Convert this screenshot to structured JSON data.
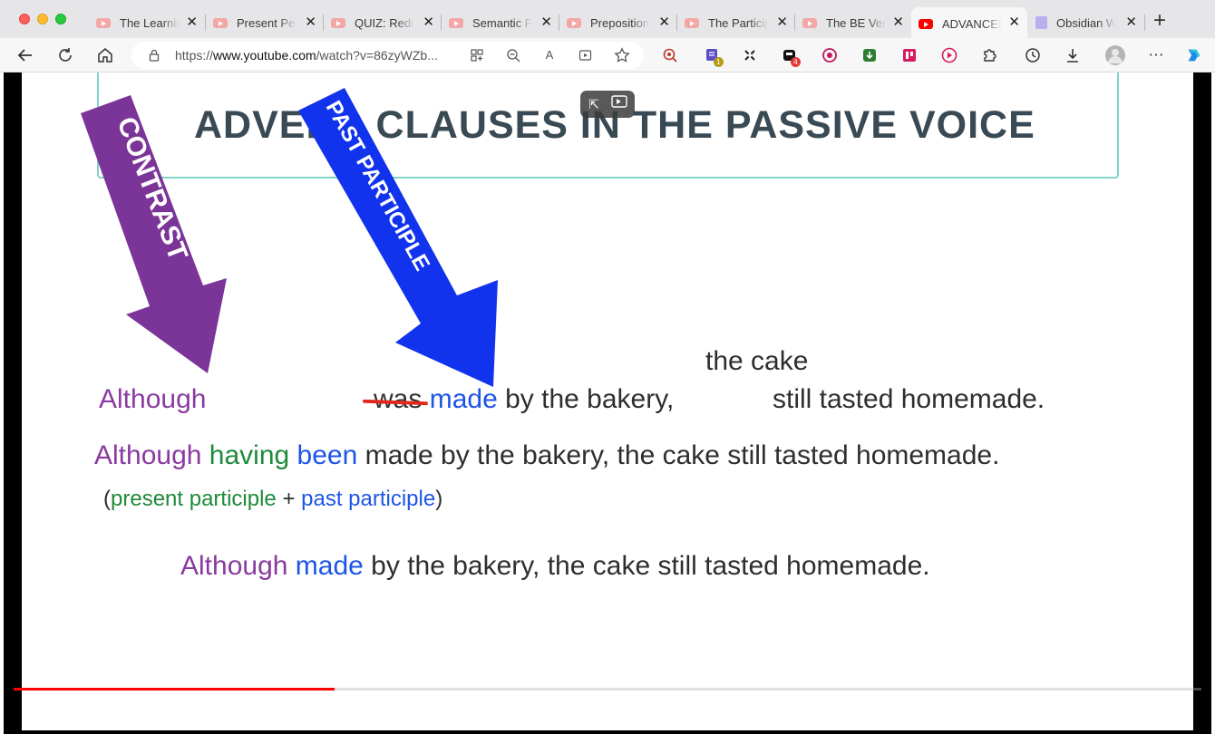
{
  "tabs": [
    {
      "title": "The Learnin",
      "active": false
    },
    {
      "title": "Present Per",
      "active": false
    },
    {
      "title": "QUIZ: Redu",
      "active": false
    },
    {
      "title": "Semantic F",
      "active": false
    },
    {
      "title": "Preposition",
      "active": false
    },
    {
      "title": "The Particip",
      "active": false
    },
    {
      "title": "The BE Ver",
      "active": false
    },
    {
      "title": "ADVANCED",
      "active": true
    },
    {
      "title": "Obsidian W",
      "active": false
    }
  ],
  "toolbar": {
    "url_prefix": "https://",
    "url_host": "www.youtube.com",
    "url_path": "/watch?v=86zyWZb...",
    "badge_one": "1",
    "badge_two": "4"
  },
  "slide": {
    "title": "ADVERB CLAUSES IN THE PASSIVE VOICE",
    "arrow_contrast": "CONTRAST",
    "arrow_past_participle": "PAST PARTICIPLE",
    "line1_subject_above": "the cake",
    "line1_although": "Although",
    "line1_was": "was",
    "line1_made": "made",
    "line1_rest": "by the bakery,",
    "line1_end": "still tasted homemade.",
    "line2_although": "Although",
    "line2_having": "having",
    "line2_been": "been",
    "line2_rest": "made by the bakery, the cake still tasted homemade.",
    "line3_open": "(",
    "line3_present": "present participle",
    "line3_plus": "+",
    "line3_past": "past participle",
    "line3_close": ")",
    "line4_although": "Although",
    "line4_made": "made",
    "line4_rest": "by the bakery, the cake still tasted homemade."
  },
  "player": {
    "progress": 0.27
  },
  "colors": {
    "contrast_arrow": "#7b3497",
    "participle_arrow": "#1133ee",
    "youtube_red": "#ff0000"
  }
}
